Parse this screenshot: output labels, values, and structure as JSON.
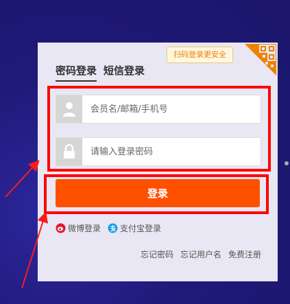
{
  "qr_tip": "扫码登录更安全",
  "tabs": [
    {
      "label": "密码登录",
      "active": true
    },
    {
      "label": "短信登录",
      "active": false
    }
  ],
  "fields": {
    "username_placeholder": "会员名/邮箱/手机号",
    "password_placeholder": "请输入登录密码"
  },
  "login_button": "登录",
  "alt_logins": {
    "weibo": "微博登录",
    "alipay": "支付宝登录"
  },
  "links": {
    "forgot_password": "忘记密码",
    "forgot_username": "忘记用户名",
    "register": "免费注册"
  },
  "colors": {
    "accent": "#ff5000",
    "background": "#1f1a78",
    "annotation": "#ff0000"
  }
}
